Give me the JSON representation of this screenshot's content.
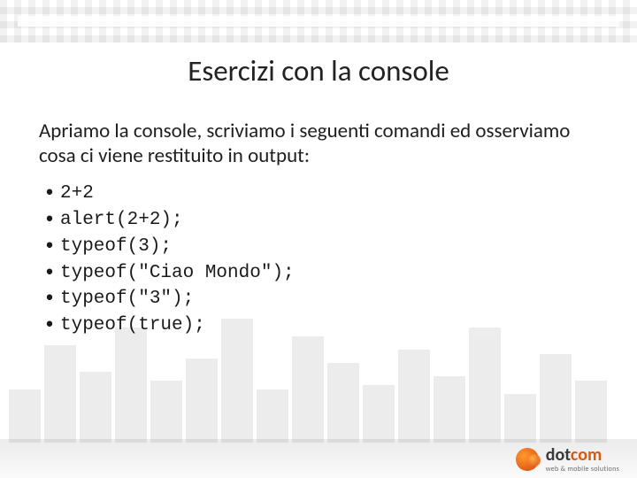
{
  "title": "Esercizi con la console",
  "intro": "Apriamo la console, scriviamo i seguenti comandi ed osserviamo cosa ci viene restituito in output:",
  "codes": [
    "2+2",
    "alert(2+2);",
    "typeof(3);",
    "typeof(\"Ciao Mondo\");",
    "typeof(\"3\");",
    "typeof(true);"
  ],
  "logo": {
    "brand_prefix": "dot",
    "brand_accent": "com",
    "tagline": "web & mobile solutions"
  }
}
